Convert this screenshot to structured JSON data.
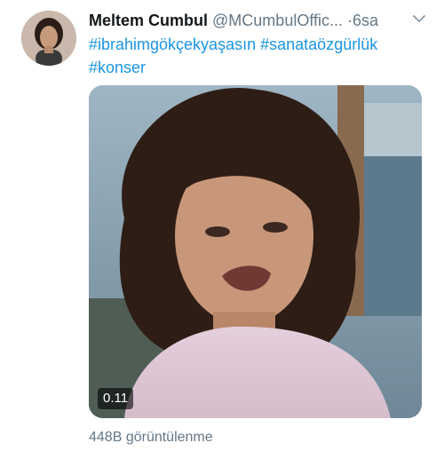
{
  "tweet": {
    "author_name": "Meltem Cumbul",
    "author_handle": "@MCumbulOffic...",
    "separator": "·",
    "time": "6sa",
    "hashtags": [
      "#ibrahimgökçekyaşasın",
      "#sanataözgürlük",
      "#konser"
    ],
    "media": {
      "duration": "0.11"
    },
    "view_count": "448B görüntülenme"
  },
  "colors": {
    "link": "#1b95e0",
    "secondary_text": "#657786",
    "primary_text": "#14171a"
  },
  "icons": {
    "menu": "chevron-down-icon"
  }
}
